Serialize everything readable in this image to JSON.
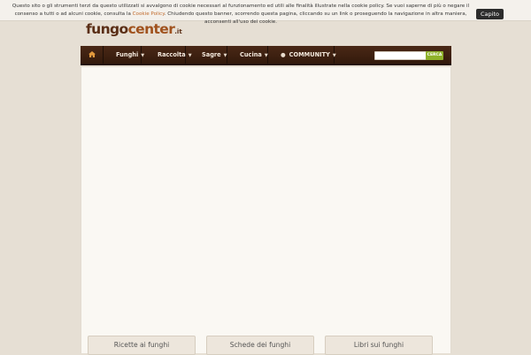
{
  "cookie_banner": {
    "text_part1": "Questo sito o gli strumenti terzi da questo utilizzati si avvalgono di cookie necessari al funzionamento ed utili alle finalità illustrate nella cookie policy. Se vuoi saperne di più o negare il consenso a tutti o ad alcuni cookie, consulta la ",
    "policy_link": "Cookie Policy",
    "text_part2": ". Chiudendo questo banner, scorrendo questa pagina, cliccando su un link o proseguendo la navigazione in altra maniera, acconsenti all'uso dei cookie.",
    "button_label": "Capito"
  },
  "logo": {
    "part1": "fungo",
    "part2": "center",
    "tld": ".it"
  },
  "nav": {
    "home_icon": "home-icon",
    "items": [
      {
        "label": "Funghi"
      },
      {
        "label": "Raccolta"
      },
      {
        "label": "Sagre"
      },
      {
        "label": "Cucina"
      },
      {
        "label": "COMMUNITY",
        "icon": "chat-icon"
      }
    ]
  },
  "search": {
    "placeholder": "",
    "button_label": "CERCA"
  },
  "bottom_links": [
    {
      "label": "Ricette ai funghi"
    },
    {
      "label": "Schede dei funghi"
    },
    {
      "label": "Libri sui funghi"
    }
  ],
  "colors": {
    "nav_bg": "#3e2011",
    "accent_green": "#8fb12a",
    "logo_brown": "#5a2e16",
    "logo_orange": "#a0521e",
    "link_orange": "#c06a2c"
  }
}
